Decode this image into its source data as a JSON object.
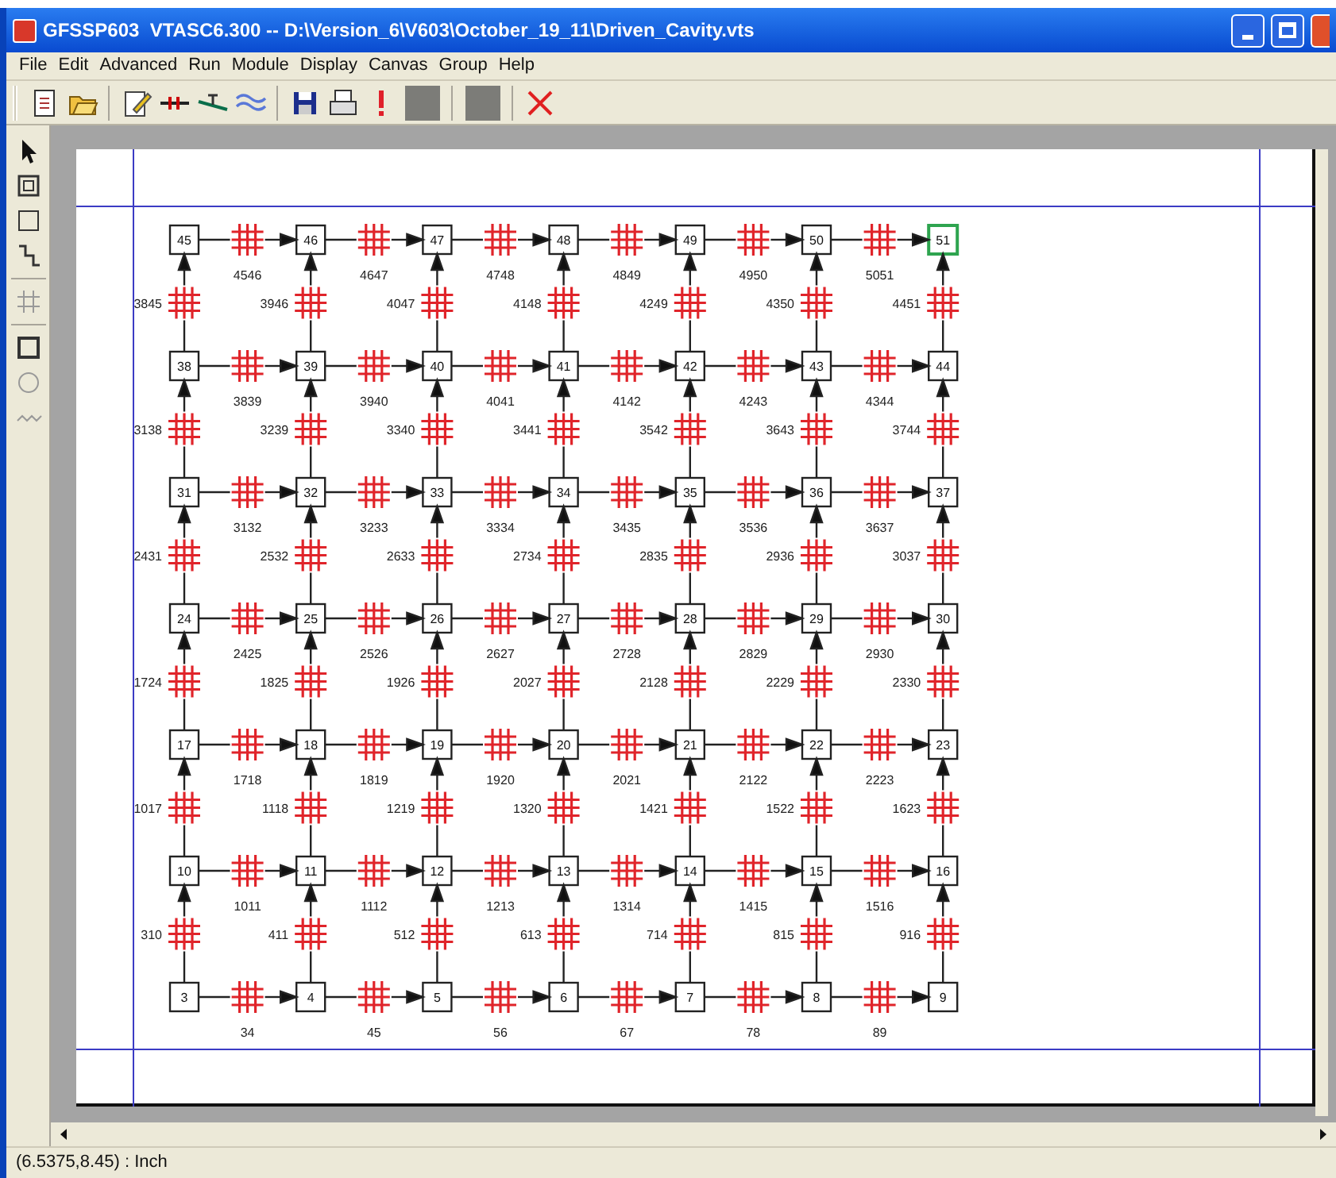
{
  "window": {
    "title": "GFSSP603  VTASC6.300 -- D:\\Version_6\\V603\\October_19_11\\Driven_Cavity.vts"
  },
  "menu": [
    "File",
    "Edit",
    "Advanced",
    "Run",
    "Module",
    "Display",
    "Canvas",
    "Group",
    "Help"
  ],
  "canvas": {
    "rows": [
      {
        "nodes": [
          {
            "label": "45",
            "selected": false
          },
          {
            "label": "46",
            "selected": false
          },
          {
            "label": "47",
            "selected": false
          },
          {
            "label": "48",
            "selected": false
          },
          {
            "label": "49",
            "selected": false
          },
          {
            "label": "50",
            "selected": false
          },
          {
            "label": "51",
            "selected": true
          }
        ],
        "branches": [
          "4546",
          "4647",
          "4748",
          "4849",
          "4950",
          "5051"
        ]
      },
      {
        "up_branches": [
          "3845",
          "3946",
          "4047",
          "4148",
          "4249",
          "4350",
          "4451"
        ],
        "nodes": [
          {
            "label": "38",
            "selected": false
          },
          {
            "label": "39",
            "selected": false
          },
          {
            "label": "40",
            "selected": false
          },
          {
            "label": "41",
            "selected": false
          },
          {
            "label": "42",
            "selected": false
          },
          {
            "label": "43",
            "selected": false
          },
          {
            "label": "44",
            "selected": false
          }
        ],
        "branches": [
          "3839",
          "3940",
          "4041",
          "4142",
          "4243",
          "4344"
        ]
      },
      {
        "up_branches": [
          "3138",
          "3239",
          "3340",
          "3441",
          "3542",
          "3643",
          "3744"
        ],
        "nodes": [
          {
            "label": "31",
            "selected": false
          },
          {
            "label": "32",
            "selected": false
          },
          {
            "label": "33",
            "selected": false
          },
          {
            "label": "34",
            "selected": false
          },
          {
            "label": "35",
            "selected": false
          },
          {
            "label": "36",
            "selected": false
          },
          {
            "label": "37",
            "selected": false
          }
        ],
        "branches": [
          "3132",
          "3233",
          "3334",
          "3435",
          "3536",
          "3637"
        ]
      },
      {
        "up_branches": [
          "2431",
          "2532",
          "2633",
          "2734",
          "2835",
          "2936",
          "3037"
        ],
        "nodes": [
          {
            "label": "24",
            "selected": false
          },
          {
            "label": "25",
            "selected": false
          },
          {
            "label": "26",
            "selected": false
          },
          {
            "label": "27",
            "selected": false
          },
          {
            "label": "28",
            "selected": false
          },
          {
            "label": "29",
            "selected": false
          },
          {
            "label": "30",
            "selected": false
          }
        ],
        "branches": [
          "2425",
          "2526",
          "2627",
          "2728",
          "2829",
          "2930"
        ]
      },
      {
        "up_branches": [
          "1724",
          "1825",
          "1926",
          "2027",
          "2128",
          "2229",
          "2330"
        ],
        "nodes": [
          {
            "label": "17",
            "selected": false
          },
          {
            "label": "18",
            "selected": false
          },
          {
            "label": "19",
            "selected": false
          },
          {
            "label": "20",
            "selected": false
          },
          {
            "label": "21",
            "selected": false
          },
          {
            "label": "22",
            "selected": false
          },
          {
            "label": "23",
            "selected": false
          }
        ],
        "branches": [
          "1718",
          "1819",
          "1920",
          "2021",
          "2122",
          "2223"
        ]
      },
      {
        "up_branches": [
          "1017",
          "1118",
          "1219",
          "1320",
          "1421",
          "1522",
          "1623"
        ],
        "nodes": [
          {
            "label": "10",
            "selected": false
          },
          {
            "label": "11",
            "selected": false
          },
          {
            "label": "12",
            "selected": false
          },
          {
            "label": "13",
            "selected": false
          },
          {
            "label": "14",
            "selected": false
          },
          {
            "label": "15",
            "selected": false
          },
          {
            "label": "16",
            "selected": false
          }
        ],
        "branches": [
          "1011",
          "1112",
          "1213",
          "1314",
          "1415",
          "1516"
        ]
      },
      {
        "up_branches": [
          "310",
          "411",
          "512",
          "613",
          "714",
          "815",
          "916"
        ],
        "nodes": [
          {
            "label": "3",
            "selected": false
          },
          {
            "label": "4",
            "selected": false
          },
          {
            "label": "5",
            "selected": false
          },
          {
            "label": "6",
            "selected": false
          },
          {
            "label": "7",
            "selected": false
          },
          {
            "label": "8",
            "selected": false
          },
          {
            "label": "9",
            "selected": false
          }
        ],
        "branches": [
          "34",
          "45",
          "56",
          "67",
          "78",
          "89"
        ]
      }
    ]
  },
  "status_bar": "(6.5375,8.45) : Inch"
}
